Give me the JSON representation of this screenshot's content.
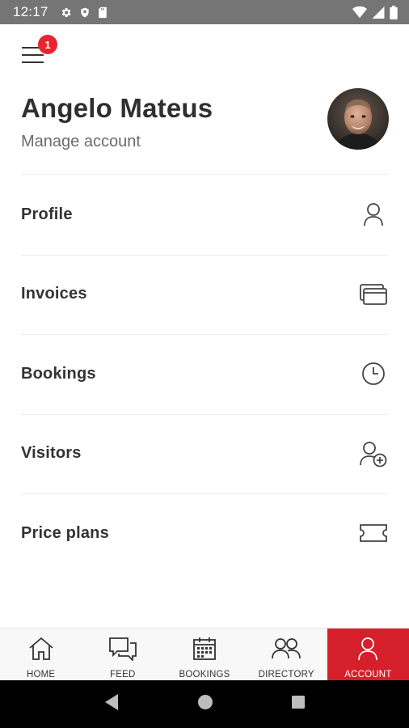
{
  "status_bar": {
    "time": "12:17",
    "left_icons": [
      "gear-icon",
      "shield-icon",
      "sd-card-icon"
    ],
    "right_icons": [
      "wifi-icon",
      "cell-signal-icon",
      "battery-icon"
    ]
  },
  "menu": {
    "badge_count": "1"
  },
  "header": {
    "user_name": "Angelo Mateus",
    "manage_account": "Manage account"
  },
  "menu_items": [
    {
      "label": "Profile",
      "icon": "person-icon"
    },
    {
      "label": "Invoices",
      "icon": "cards-icon"
    },
    {
      "label": "Bookings",
      "icon": "clock-icon"
    },
    {
      "label": "Visitors",
      "icon": "add-person-icon"
    },
    {
      "label": "Price plans",
      "icon": "ticket-icon"
    }
  ],
  "bottom_nav": {
    "active": "ACCOUNT",
    "items": [
      {
        "label": "HOME",
        "icon": "home-icon"
      },
      {
        "label": "FEED",
        "icon": "chat-icon"
      },
      {
        "label": "BOOKINGS",
        "icon": "calendar-icon"
      },
      {
        "label": "DIRECTORY",
        "icon": "people-icon"
      },
      {
        "label": "ACCOUNT",
        "icon": "person-icon"
      }
    ]
  },
  "colors": {
    "accent": "#d5202b",
    "badge": "#e8252e",
    "status_bar": "#757575"
  }
}
